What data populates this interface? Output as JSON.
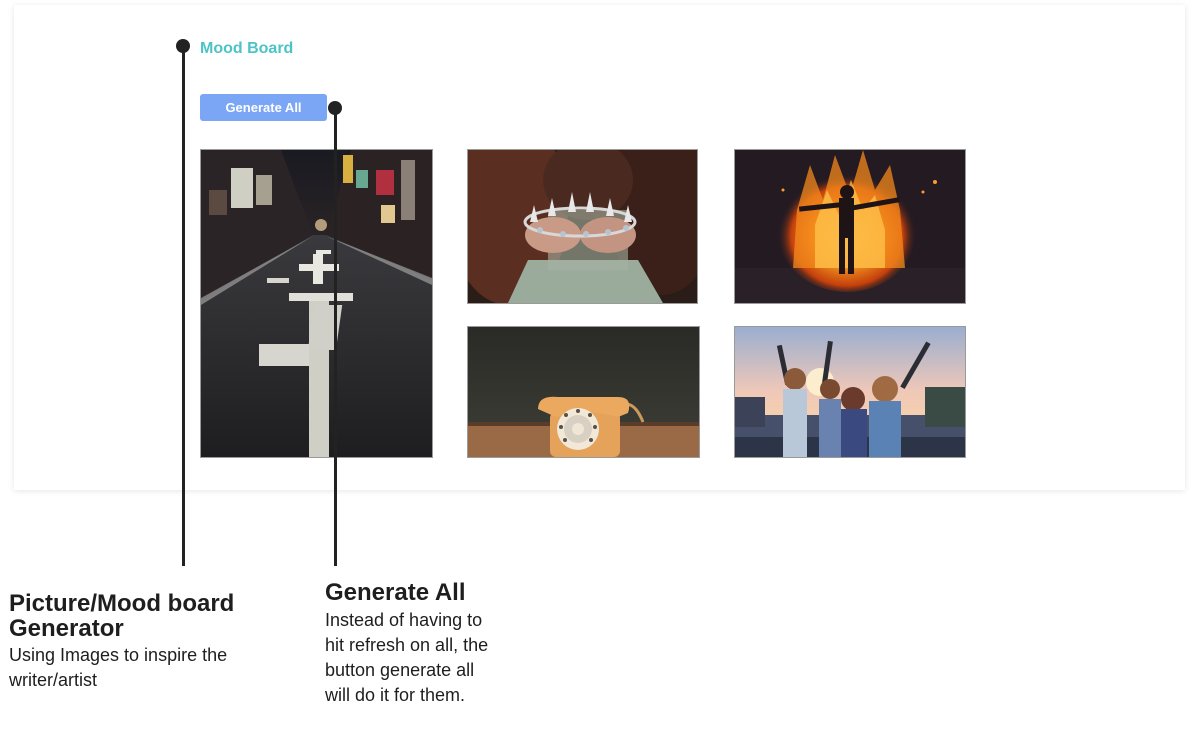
{
  "mood_board": {
    "title": "Mood Board",
    "generate_button": "Generate All",
    "accent_color": "#4cc3c6",
    "button_color": "#7aa6f5",
    "images": [
      {
        "name": "night-street-photo",
        "subject": "empty city street at night"
      },
      {
        "name": "crown-hands-photo",
        "subject": "hands holding a crown"
      },
      {
        "name": "fire-silhouette-photo",
        "subject": "silhouette in front of fire"
      },
      {
        "name": "rotary-phone-photo",
        "subject": "orange rotary telephone"
      },
      {
        "name": "friends-sunset-photo",
        "subject": "friends raising arms at sunset"
      }
    ]
  },
  "annotations": {
    "board": {
      "title_line1": "Picture/Mood board",
      "title_line2": "Generator",
      "body_line1": "Using Images to inspire the",
      "body_line2": "writer/artist"
    },
    "button": {
      "title": "Generate All",
      "body_line1": "Instead of having to",
      "body_line2": "hit refresh on all, the",
      "body_line3": "button generate all",
      "body_line4": "will do it for them."
    }
  }
}
